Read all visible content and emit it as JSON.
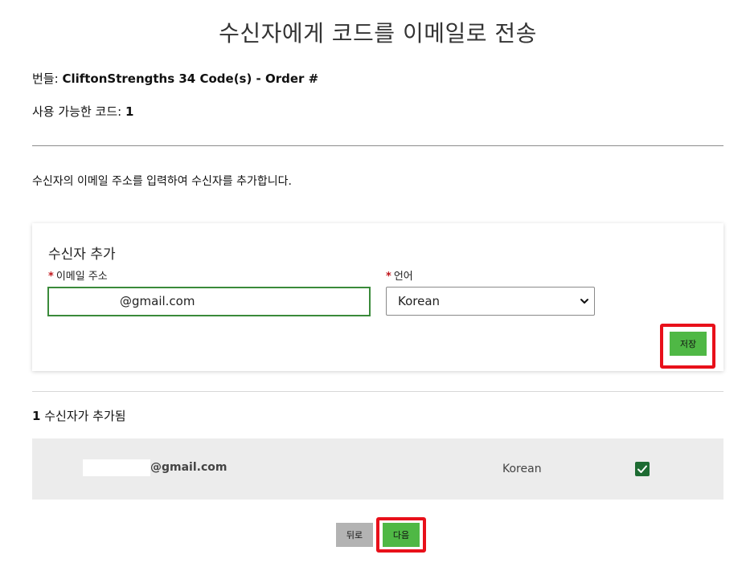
{
  "page": {
    "title": "수신자에게 코드를 이메일로 전송"
  },
  "bundle": {
    "label": "번들:",
    "value": "CliftonStrengths 34 Code(s) - Order #"
  },
  "available": {
    "label": "사용 가능한 코드:",
    "value": "1"
  },
  "instruction": "수신자의 이메일 주소를 입력하여 수신자를 추가합니다.",
  "add_form": {
    "title": "수신자 추가",
    "email_label": "이메일 주소",
    "email_value": "@gmail.com",
    "language_label": "언어",
    "language_value": "Korean",
    "required_marker": "*",
    "save_label": "저장"
  },
  "added": {
    "count": "1",
    "label": "수신자가 추가됨",
    "rows": [
      {
        "email": "@gmail.com",
        "language": "Korean",
        "checked": true
      }
    ]
  },
  "footer": {
    "back_label": "뒤로",
    "next_label": "다음"
  },
  "colors": {
    "accent_green": "#4fb845",
    "input_border_green": "#3a8a3a",
    "checkbox_green": "#1d6b32",
    "highlight_red": "#e8101a",
    "required_red": "#c0161c",
    "back_button_grey": "#b3b3b3",
    "row_background": "#ececec"
  },
  "icons": {
    "select_arrow": "chevron-down-icon",
    "row_check": "checkmark-icon"
  }
}
